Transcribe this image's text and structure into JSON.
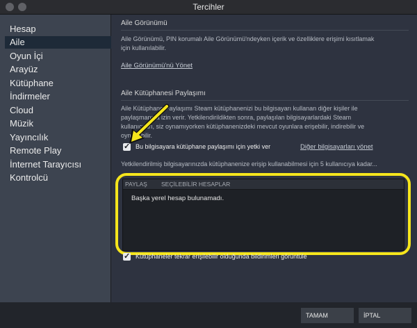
{
  "window": {
    "title": "Tercihler"
  },
  "sidebar": {
    "items": [
      {
        "label": "Hesap"
      },
      {
        "label": "Aile"
      },
      {
        "label": "Oyun İçi"
      },
      {
        "label": "Arayüz"
      },
      {
        "label": "Kütüphane"
      },
      {
        "label": "İndirmeler"
      },
      {
        "label": "Cloud"
      },
      {
        "label": "Müzik"
      },
      {
        "label": "Yayıncılık"
      },
      {
        "label": "Remote Play"
      },
      {
        "label": "İnternet Tarayıcısı"
      },
      {
        "label": "Kontrolcü"
      }
    ],
    "selected": "Aile"
  },
  "family_view": {
    "heading": "Aile Görünümü",
    "description_line1": "Aile Görünümü, PIN korumalı Aile Görünümü'ndeyken içerik ve özelliklere erişimi kısıtlamak",
    "description_line2": "için kullanılabilir.",
    "manage_link": "Aile Görünümü'nü Yönet"
  },
  "library_sharing": {
    "heading": "Aile Kütüphanesi Paylaşımı",
    "description_line1": "Aile Kütüphane Paylaşımı Steam kütüphanenizi bu bilgisayarı kullanan diğer kişiler ile",
    "description_line2": "paylaşmanıza izin verir. Yetkilendirildikten sonra, paylaşılan bilgisayarlardaki Steam",
    "description_line3": "kullanıcıları, siz oynamıyorken kütüphanenizdeki mevcut oyunlara erişebilir, indirebilir ve",
    "description_line4": "oynayabilir.",
    "authorize_checkbox_label": "Bu bilgisayara kütüphane paylaşımı için yetki ver",
    "authorize_checked": true,
    "other_computers_link": "Diğer bilgisayarları yönet",
    "users_info": "Yetkilendirilmiş bilgisayarınızda kütüphanenize erişip kullanabilmesi için 5 kullanıcıya kadar...",
    "table": {
      "col_share": "PAYLAŞ",
      "col_accounts": "SEÇİLEBİLİR HESAPLAR",
      "empty_text": "Başka yerel hesap bulunamadı."
    },
    "notify_checkbox_label": "Kütüphaneler tekrar erişilebilir olduğunda bildirimleri görüntüle",
    "notify_checked": true
  },
  "footer": {
    "ok_label": "TAMAM",
    "cancel_label": "İPTAL"
  },
  "colors": {
    "highlight": "#f5e51c",
    "sidebar_bg": "#3d4450",
    "selected_bg": "#1e2a38",
    "main_bg": "#2e3340"
  }
}
